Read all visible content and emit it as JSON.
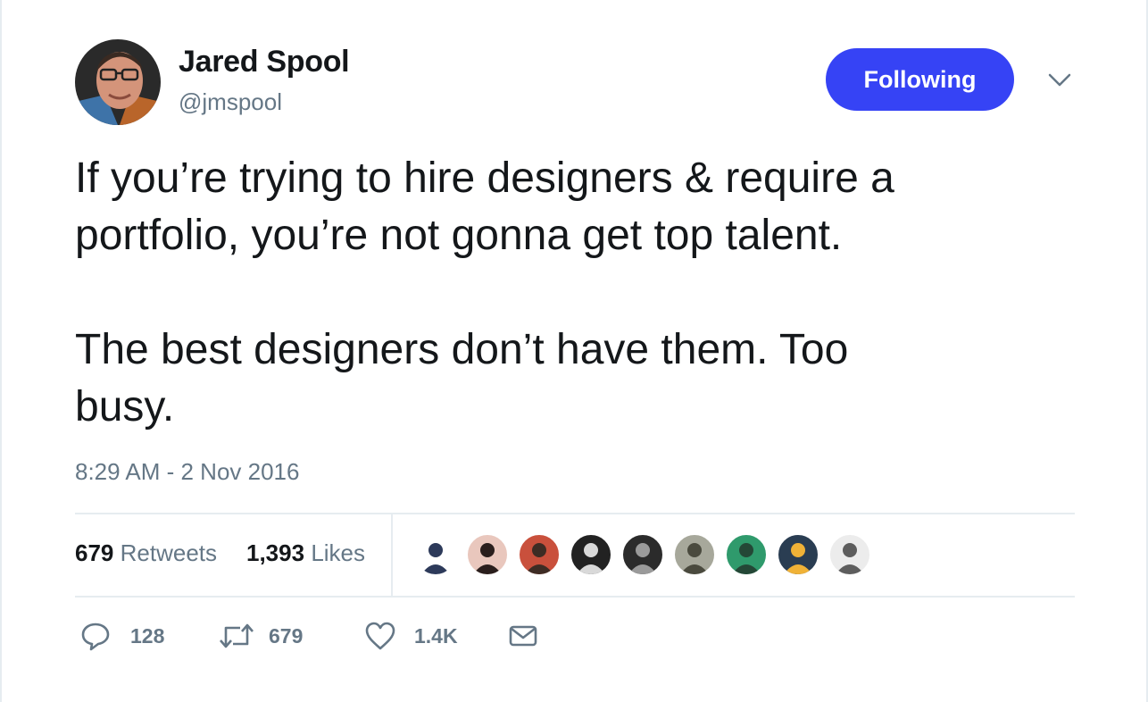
{
  "author": {
    "name": "Jared Spool",
    "handle": "@jmspool",
    "avatar_icon": "profile-photo"
  },
  "follow_button": {
    "label": "Following",
    "color": "#3643f5"
  },
  "menu": {
    "icon": "chevron-down-icon"
  },
  "tweet": {
    "text": "If you’re trying to hire designers & require a\nportfolio, you’re not gonna get top talent.\n\nThe best designers don’t have them. Too\nbusy.",
    "timestamp": "8:29 AM - 2 Nov 2016"
  },
  "stats": {
    "retweets": {
      "count": "679",
      "label": "Retweets"
    },
    "likes": {
      "count": "1,393",
      "label": "Likes"
    }
  },
  "likers": [
    {
      "icon": "liker-avatar",
      "bg": "#ffffff",
      "fg": "#2d3a5a"
    },
    {
      "icon": "liker-avatar",
      "bg": "#e9c7bd",
      "fg": "#2a1e1c"
    },
    {
      "icon": "liker-avatar",
      "bg": "#c9503c",
      "fg": "#3e2c24"
    },
    {
      "icon": "liker-avatar",
      "bg": "#222222",
      "fg": "#d9d9d9"
    },
    {
      "icon": "liker-avatar",
      "bg": "#2b2b2b",
      "fg": "#9a9a9a"
    },
    {
      "icon": "liker-avatar",
      "bg": "#a7a89b",
      "fg": "#4a4a3e"
    },
    {
      "icon": "liker-avatar",
      "bg": "#2f9a6c",
      "fg": "#244736"
    },
    {
      "icon": "liker-avatar",
      "bg": "#2a3d52",
      "fg": "#f0b237"
    },
    {
      "icon": "liker-avatar",
      "bg": "#ececec",
      "fg": "#5d5d5d"
    }
  ],
  "actions": {
    "reply": {
      "icon": "reply-icon",
      "count": "128"
    },
    "retweet": {
      "icon": "retweet-icon",
      "count": "679"
    },
    "like": {
      "icon": "heart-icon",
      "count": "1.4K"
    },
    "message": {
      "icon": "envelope-icon"
    }
  }
}
